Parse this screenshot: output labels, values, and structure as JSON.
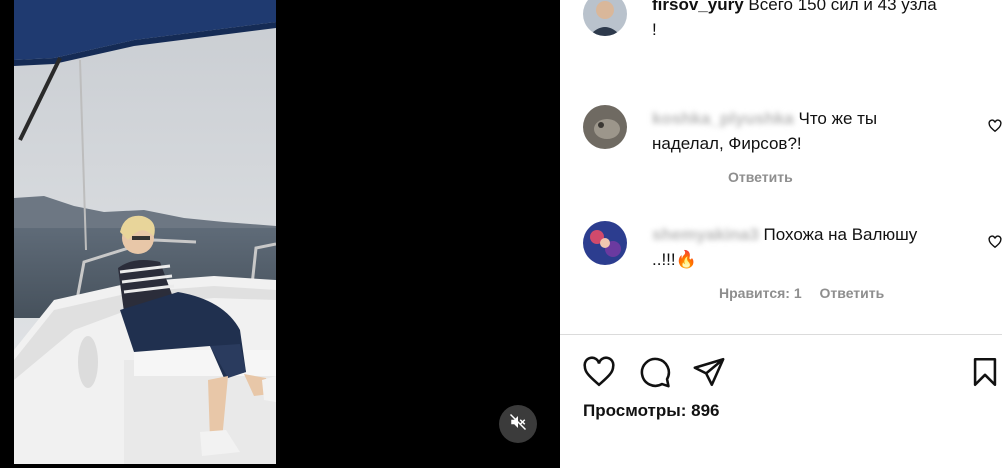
{
  "post": {
    "caption": {
      "username": "firsov_yury",
      "text": "Всего 150 сил и 43 узла",
      "text_cont": "!"
    },
    "comments": [
      {
        "username": "koshka_plyushka",
        "text_line1": "Что же ты",
        "text_line2": "наделал, Фирсов?!",
        "reply_label": "Ответить"
      },
      {
        "username": "shemyakina3",
        "text_line1": "Похожа на Валюшу",
        "text_line2": "..!!!🔥",
        "likes_label": "Нравится: 1",
        "reply_label": "Ответить"
      }
    ],
    "views_label": "Просмотры: 896"
  },
  "icons": {
    "mute": "speaker-muted-icon",
    "like": "heart-icon",
    "comment": "comment-bubble-icon",
    "share": "paper-plane-icon",
    "save": "bookmark-icon"
  },
  "colors": {
    "secondary_text": "#8e8e8e",
    "divider": "#dbdbdb",
    "video_bg": "#000000"
  }
}
